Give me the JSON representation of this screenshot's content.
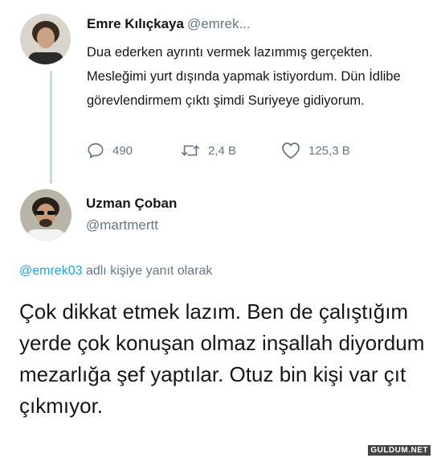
{
  "tweet1": {
    "author_name": "Emre Kılıçkaya",
    "author_handle": "@emrek...",
    "text": "Dua ederken ayrıntı vermek lazımmış gerçekten. Mesleğimi yurt dışında yapmak istiyordum. Dün İdlibe görevlendirmem çıktı şimdi Suriyeye gidiyorum.",
    "reply_count": "490",
    "retweet_count": "2,4 B",
    "like_count": "125,3 B"
  },
  "tweet2": {
    "author_name": "Uzman Çoban",
    "author_handle": "@martmertt",
    "reply_to_handle": "@emrek03",
    "reply_to_suffix": " adlı kişiye yanıt olarak",
    "text": "Çok dikkat etmek lazım. Ben de çalıştığım yerde çok konuşan olmaz inşallah diyordum mezarlığa şef yaptılar. Otuz bin kişi var çıt çıkmıyor."
  },
  "watermark": "GULDUM.NET",
  "icons": {
    "reply": "reply-icon",
    "retweet": "retweet-icon",
    "like": "heart-icon"
  },
  "colors": {
    "text": "#14171a",
    "secondary": "#657786",
    "link": "#1da1f2",
    "thread_line": "#cfd9de"
  }
}
